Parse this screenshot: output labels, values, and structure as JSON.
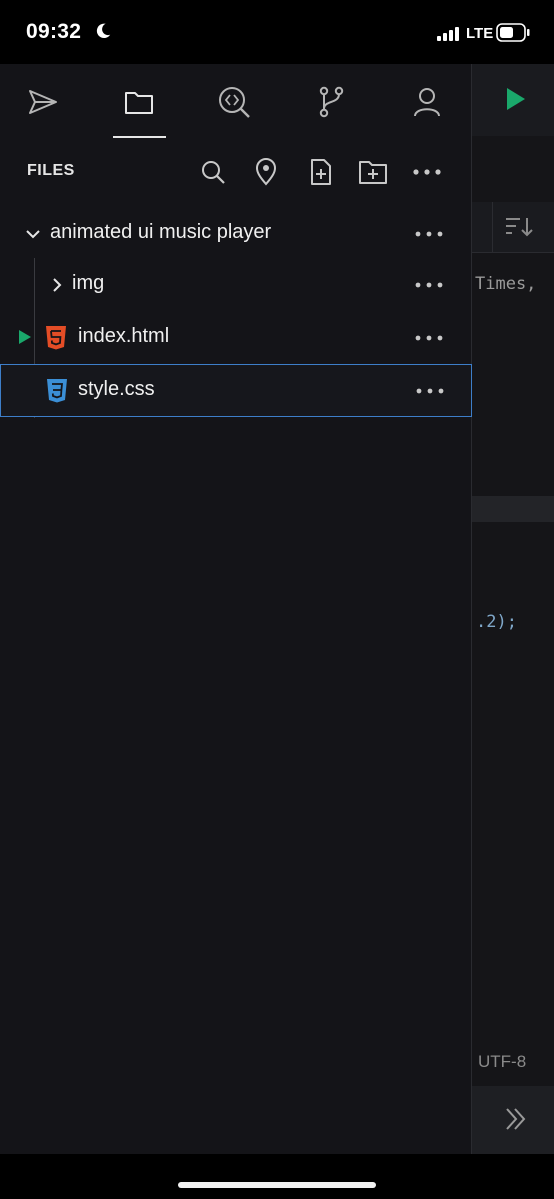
{
  "status_bar": {
    "time": "09:32",
    "network": "LTE"
  },
  "editor": {
    "code_line_1": "Times,",
    "code_line_2": ".2);",
    "encoding": "UTF-8"
  },
  "sidebar": {
    "tabs": [
      "send",
      "files",
      "code-search",
      "git",
      "account"
    ],
    "active_tab": "files",
    "header_title": "FILES",
    "tree": {
      "folder": "animated ui music player",
      "items": [
        {
          "label": "img",
          "type": "folder"
        },
        {
          "label": "index.html",
          "type": "html",
          "running": true
        },
        {
          "label": "style.css",
          "type": "css",
          "selected": true
        }
      ]
    }
  },
  "colors": {
    "accent_green": "#1aa86b",
    "html_orange": "#e44d26",
    "css_blue": "#3b8fd6",
    "selection_border": "#3d7ec9"
  }
}
